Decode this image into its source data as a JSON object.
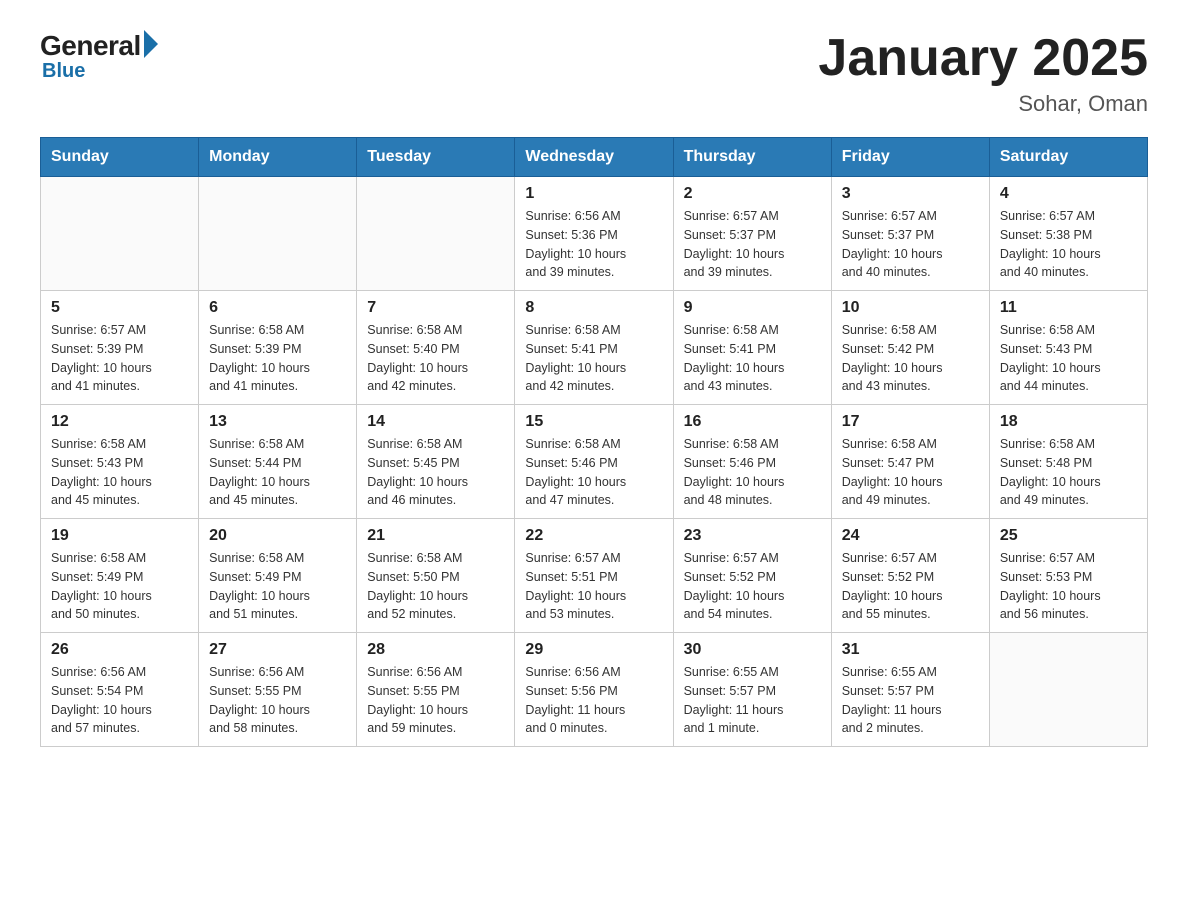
{
  "header": {
    "logo": {
      "general": "General",
      "blue": "Blue",
      "line2": "Blue"
    },
    "title": "January 2025",
    "location": "Sohar, Oman"
  },
  "days_of_week": [
    "Sunday",
    "Monday",
    "Tuesday",
    "Wednesday",
    "Thursday",
    "Friday",
    "Saturday"
  ],
  "weeks": [
    [
      {
        "day": "",
        "info": ""
      },
      {
        "day": "",
        "info": ""
      },
      {
        "day": "",
        "info": ""
      },
      {
        "day": "1",
        "info": "Sunrise: 6:56 AM\nSunset: 5:36 PM\nDaylight: 10 hours\nand 39 minutes."
      },
      {
        "day": "2",
        "info": "Sunrise: 6:57 AM\nSunset: 5:37 PM\nDaylight: 10 hours\nand 39 minutes."
      },
      {
        "day": "3",
        "info": "Sunrise: 6:57 AM\nSunset: 5:37 PM\nDaylight: 10 hours\nand 40 minutes."
      },
      {
        "day": "4",
        "info": "Sunrise: 6:57 AM\nSunset: 5:38 PM\nDaylight: 10 hours\nand 40 minutes."
      }
    ],
    [
      {
        "day": "5",
        "info": "Sunrise: 6:57 AM\nSunset: 5:39 PM\nDaylight: 10 hours\nand 41 minutes."
      },
      {
        "day": "6",
        "info": "Sunrise: 6:58 AM\nSunset: 5:39 PM\nDaylight: 10 hours\nand 41 minutes."
      },
      {
        "day": "7",
        "info": "Sunrise: 6:58 AM\nSunset: 5:40 PM\nDaylight: 10 hours\nand 42 minutes."
      },
      {
        "day": "8",
        "info": "Sunrise: 6:58 AM\nSunset: 5:41 PM\nDaylight: 10 hours\nand 42 minutes."
      },
      {
        "day": "9",
        "info": "Sunrise: 6:58 AM\nSunset: 5:41 PM\nDaylight: 10 hours\nand 43 minutes."
      },
      {
        "day": "10",
        "info": "Sunrise: 6:58 AM\nSunset: 5:42 PM\nDaylight: 10 hours\nand 43 minutes."
      },
      {
        "day": "11",
        "info": "Sunrise: 6:58 AM\nSunset: 5:43 PM\nDaylight: 10 hours\nand 44 minutes."
      }
    ],
    [
      {
        "day": "12",
        "info": "Sunrise: 6:58 AM\nSunset: 5:43 PM\nDaylight: 10 hours\nand 45 minutes."
      },
      {
        "day": "13",
        "info": "Sunrise: 6:58 AM\nSunset: 5:44 PM\nDaylight: 10 hours\nand 45 minutes."
      },
      {
        "day": "14",
        "info": "Sunrise: 6:58 AM\nSunset: 5:45 PM\nDaylight: 10 hours\nand 46 minutes."
      },
      {
        "day": "15",
        "info": "Sunrise: 6:58 AM\nSunset: 5:46 PM\nDaylight: 10 hours\nand 47 minutes."
      },
      {
        "day": "16",
        "info": "Sunrise: 6:58 AM\nSunset: 5:46 PM\nDaylight: 10 hours\nand 48 minutes."
      },
      {
        "day": "17",
        "info": "Sunrise: 6:58 AM\nSunset: 5:47 PM\nDaylight: 10 hours\nand 49 minutes."
      },
      {
        "day": "18",
        "info": "Sunrise: 6:58 AM\nSunset: 5:48 PM\nDaylight: 10 hours\nand 49 minutes."
      }
    ],
    [
      {
        "day": "19",
        "info": "Sunrise: 6:58 AM\nSunset: 5:49 PM\nDaylight: 10 hours\nand 50 minutes."
      },
      {
        "day": "20",
        "info": "Sunrise: 6:58 AM\nSunset: 5:49 PM\nDaylight: 10 hours\nand 51 minutes."
      },
      {
        "day": "21",
        "info": "Sunrise: 6:58 AM\nSunset: 5:50 PM\nDaylight: 10 hours\nand 52 minutes."
      },
      {
        "day": "22",
        "info": "Sunrise: 6:57 AM\nSunset: 5:51 PM\nDaylight: 10 hours\nand 53 minutes."
      },
      {
        "day": "23",
        "info": "Sunrise: 6:57 AM\nSunset: 5:52 PM\nDaylight: 10 hours\nand 54 minutes."
      },
      {
        "day": "24",
        "info": "Sunrise: 6:57 AM\nSunset: 5:52 PM\nDaylight: 10 hours\nand 55 minutes."
      },
      {
        "day": "25",
        "info": "Sunrise: 6:57 AM\nSunset: 5:53 PM\nDaylight: 10 hours\nand 56 minutes."
      }
    ],
    [
      {
        "day": "26",
        "info": "Sunrise: 6:56 AM\nSunset: 5:54 PM\nDaylight: 10 hours\nand 57 minutes."
      },
      {
        "day": "27",
        "info": "Sunrise: 6:56 AM\nSunset: 5:55 PM\nDaylight: 10 hours\nand 58 minutes."
      },
      {
        "day": "28",
        "info": "Sunrise: 6:56 AM\nSunset: 5:55 PM\nDaylight: 10 hours\nand 59 minutes."
      },
      {
        "day": "29",
        "info": "Sunrise: 6:56 AM\nSunset: 5:56 PM\nDaylight: 11 hours\nand 0 minutes."
      },
      {
        "day": "30",
        "info": "Sunrise: 6:55 AM\nSunset: 5:57 PM\nDaylight: 11 hours\nand 1 minute."
      },
      {
        "day": "31",
        "info": "Sunrise: 6:55 AM\nSunset: 5:57 PM\nDaylight: 11 hours\nand 2 minutes."
      },
      {
        "day": "",
        "info": ""
      }
    ]
  ]
}
